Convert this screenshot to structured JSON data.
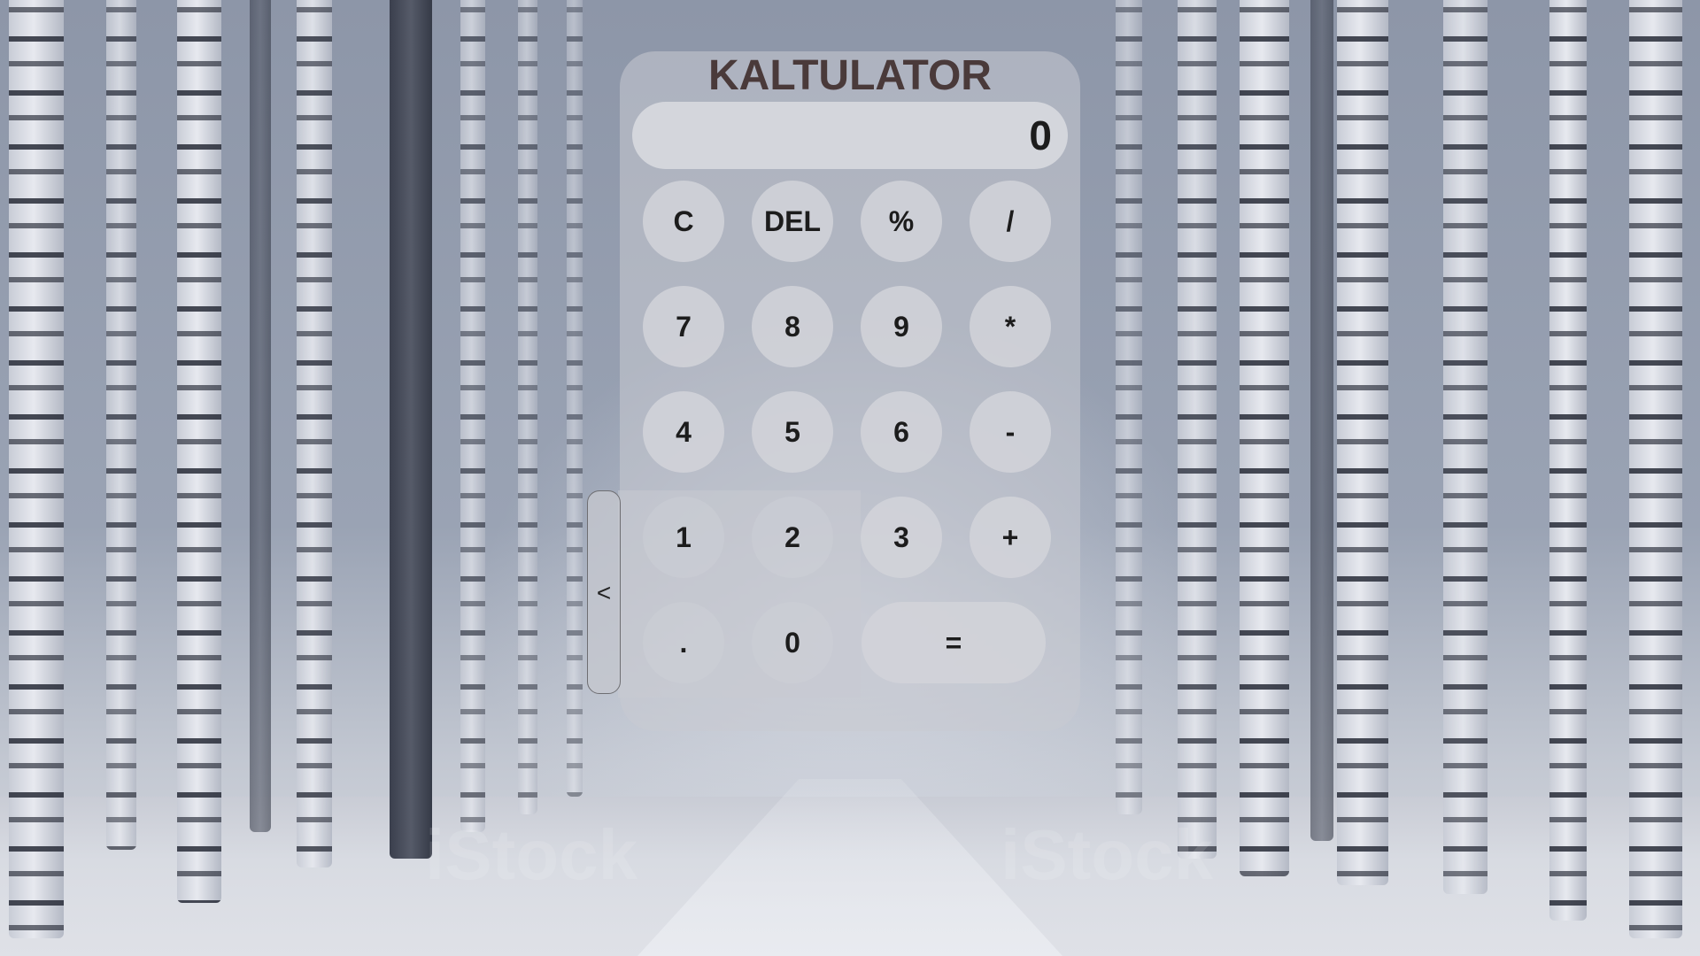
{
  "app": {
    "title": "KALTULATOR"
  },
  "display": {
    "value": "0"
  },
  "keys": {
    "clear": "C",
    "delete": "DEL",
    "percent": "%",
    "divide": "/",
    "seven": "7",
    "eight": "8",
    "nine": "9",
    "multiply": "*",
    "four": "4",
    "five": "5",
    "six": "6",
    "subtract": "-",
    "one": "1",
    "two": "2",
    "three": "3",
    "add": "+",
    "decimal": ".",
    "zero": "0",
    "equals": "="
  },
  "side_toggle": {
    "label": "<"
  },
  "theme": {
    "title_color": "#4a3a3a",
    "panel_color": "#c8cbd2",
    "button_color": "#d2d4d9",
    "text_color": "#1c1c1c"
  },
  "background": {
    "scene": "snowy-birch-forest"
  }
}
